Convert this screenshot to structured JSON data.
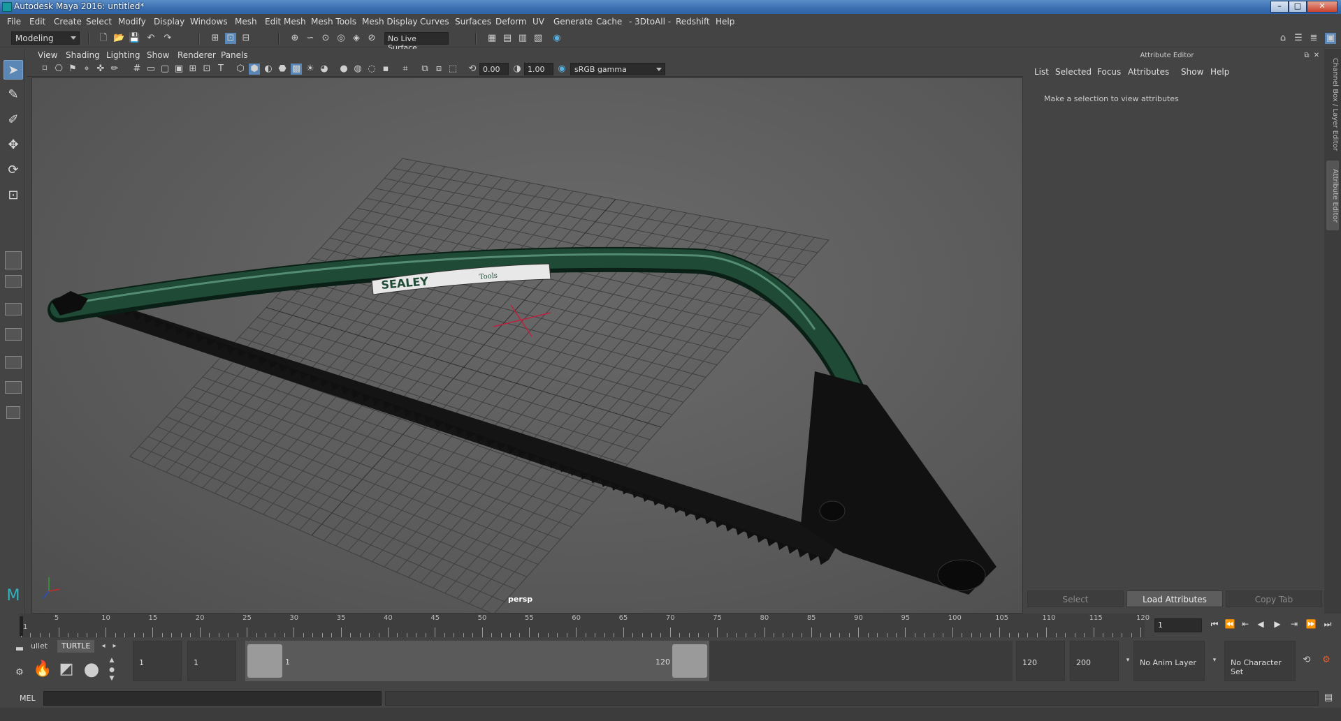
{
  "window": {
    "title": "Autodesk Maya 2016: untitled*",
    "minimize": "–",
    "maximize": "□",
    "close": "✕"
  },
  "menus": [
    "File",
    "Edit",
    "Create",
    "Select",
    "Modify",
    "Display",
    "Windows",
    "Mesh",
    "Edit Mesh",
    "Mesh Tools",
    "Mesh Display",
    "Curves",
    "Surfaces",
    "Deform",
    "UV",
    "Generate",
    "Cache",
    "- 3DtoAll -",
    "Redshift",
    "Help"
  ],
  "statusline": {
    "mode": "Modeling",
    "live_surface": "No Live Surface"
  },
  "panel": {
    "menus": [
      "View",
      "Shading",
      "Lighting",
      "Show",
      "Renderer",
      "Panels"
    ],
    "exposure": "0.00",
    "gamma": "1.00",
    "color_space": "sRGB gamma",
    "camera": "persp"
  },
  "model": {
    "brand": "SEALEY",
    "sub": "Tools"
  },
  "attribute_editor": {
    "title": "Attribute Editor",
    "menus": [
      "List",
      "Selected",
      "Focus",
      "Attributes",
      "Show",
      "Help"
    ],
    "message": "Make a selection to view attributes",
    "buttons": {
      "select": "Select",
      "load": "Load Attributes",
      "copy": "Copy Tab"
    },
    "side_tabs": [
      "Channel Box / Layer Editor",
      "Attribute Editor"
    ]
  },
  "timeline": {
    "start": 1,
    "end": 120,
    "labels": [
      "1",
      "5",
      "10",
      "15",
      "20",
      "25",
      "30",
      "35",
      "40",
      "45",
      "50",
      "55",
      "60",
      "65",
      "70",
      "75",
      "80",
      "85",
      "90",
      "95",
      "100",
      "105",
      "110",
      "115",
      "120"
    ],
    "current_frame": "1"
  },
  "range": {
    "shelf_tabs": [
      "ullet",
      "TURTLE"
    ],
    "start_field": "1",
    "playback_start": "1",
    "range_start_label": "1",
    "range_end_label": "120",
    "playback_end": "120",
    "end_field": "200",
    "anim_layer": "No Anim Layer",
    "character_set": "No Character Set"
  },
  "cmdline": {
    "label": "MEL"
  },
  "colors": {
    "accent": "#5a87b6",
    "saw_frame": "#1f4a35",
    "blade": "#141414",
    "grid": "#3e3e3e"
  }
}
